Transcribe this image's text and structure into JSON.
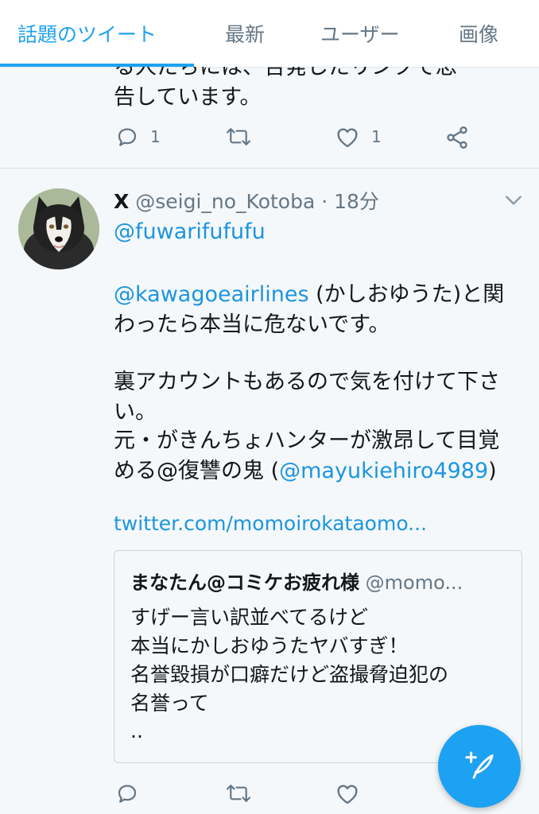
{
  "tabs": [
    {
      "label": "話題のツイート",
      "active": true
    },
    {
      "label": "最新"
    },
    {
      "label": "ユーザー"
    },
    {
      "label": "画像"
    }
  ],
  "previous_tweet": {
    "clipped_text_top": "る人たちには、告発したリンクで忠",
    "clipped_text": "告しています。",
    "reply_count": "1",
    "like_count": "1"
  },
  "tweet": {
    "display_name": "X",
    "handle": "@seigi_no_Kotoba",
    "separator": " · ",
    "time": "18分",
    "reply_to": "@fuwarifufufu",
    "line1_mention": "@kawagoeairlines",
    "line1_rest": " (かしおゆうた)と関",
    "line2": "わったら本当に危ないです。",
    "line3": "裏アカウントもあるので気を付けて下さ",
    "line4": "い。",
    "line5": "元・がきんちょハンターが激昂して目覚",
    "line6_prefix": "める@復讐の鬼 (",
    "line6_mention": "@mayukiehiro4989",
    "line6_suffix": ")",
    "link": "twitter.com/momoirokataomo..."
  },
  "quote": {
    "name": "まなたん@コミケお疲れ様",
    "handle": "@momo...",
    "line1": "すげー言い訳並べてるけど",
    "line2": "本当にかしおゆうたヤバすぎ！",
    "line3": "名誉毀損が口癖だけど盗撮脅迫犯の",
    "line4": "名誉って",
    "line5": ".."
  },
  "icons": {
    "reply": "reply-icon",
    "retweet": "retweet-icon",
    "like": "heart-icon",
    "share": "share-icon",
    "compose": "compose-icon",
    "menu": "chevron-down-icon"
  },
  "colors": {
    "accent": "#1da1f2",
    "link": "#1b95e0",
    "secondary_text": "#657786",
    "background": "#f5f8fa"
  }
}
